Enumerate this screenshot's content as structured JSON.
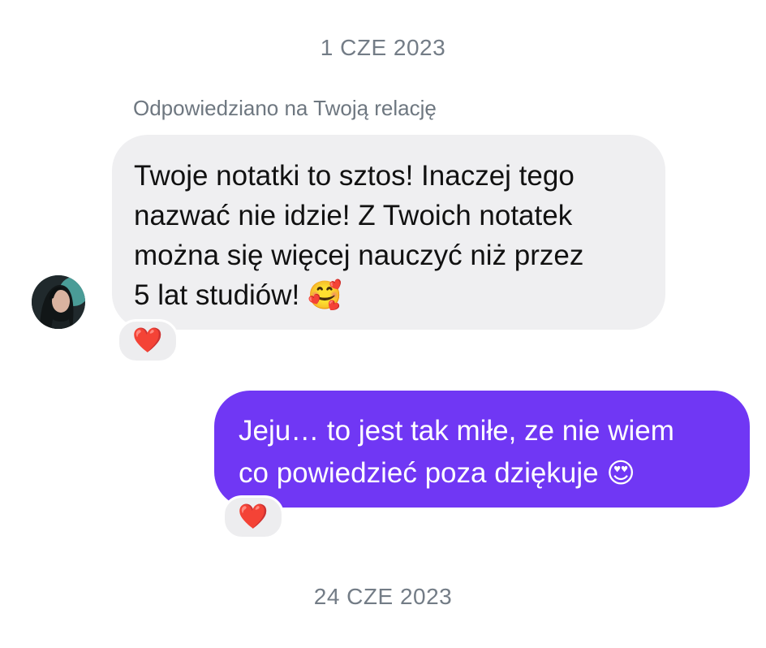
{
  "dates": {
    "top": "1 CZE 2023",
    "bottom": "24 CZE 2023"
  },
  "incoming": {
    "reply_context": "Odpowiedziano na Twoją relację",
    "text": "Twoje notatki to sztos! Inaczej tego\nnazwać nie idzie! Z Twoich notatek\nmożna się więcej nauczyć niż przez\n5 lat studiów!",
    "emoji": "🥰",
    "reaction": "❤️"
  },
  "outgoing": {
    "text": "Jeju… to jest tak miłe, ze nie wiem\nco powiedzieć poza dziękuje",
    "emoji": "😍",
    "reaction": "❤️"
  },
  "colors": {
    "outgoing_bubble": "#7037f4",
    "incoming_bubble": "#efeff1",
    "date_text": "#737c86"
  },
  "icons": {
    "reaction": "red-heart-icon",
    "avatar": "user-avatar"
  }
}
